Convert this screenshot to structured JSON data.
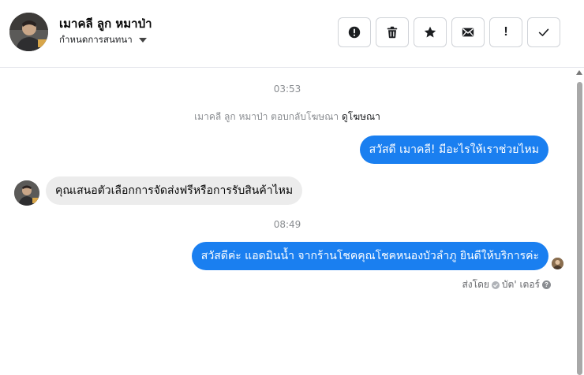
{
  "header": {
    "contact_name": "เมาคลี ลูก หมาป่า",
    "assign_label": "กำหนดการสนทนา",
    "toolbar": {
      "report_icon": "alert-circle-icon",
      "delete_icon": "trash-icon",
      "star_icon": "star-icon",
      "mail_icon": "envelope-icon",
      "follow_up_label": "!",
      "done_icon": "checkmark-icon"
    }
  },
  "thread": {
    "time_1": "03:53",
    "system_text": "เมาคลี ลูก หมาป่า ตอบกลับโฆษณา",
    "system_link": "ดูโฆษณา",
    "msg_1": "สวัสดี เมาคลี! มีอะไรให้เราช่วยไหม",
    "msg_2": "คุณเสนอตัวเลือกการจัดส่งฟรีหรือการรับสินค้าไหม",
    "time_2": "08:49",
    "msg_3": "สวัสดีค่ะ แอดมินน้ำ จากร้านโชคคุณโชคหนองบัวลำภู ยินดีให้บริการค่ะ",
    "sent_by_label": "ส่งโดย",
    "sent_by_name": "บัต' เตอร์"
  },
  "colors": {
    "outgoing_bubble": "#1a7ff0",
    "incoming_bubble": "#ececec",
    "meta_text": "#8a8d91"
  }
}
